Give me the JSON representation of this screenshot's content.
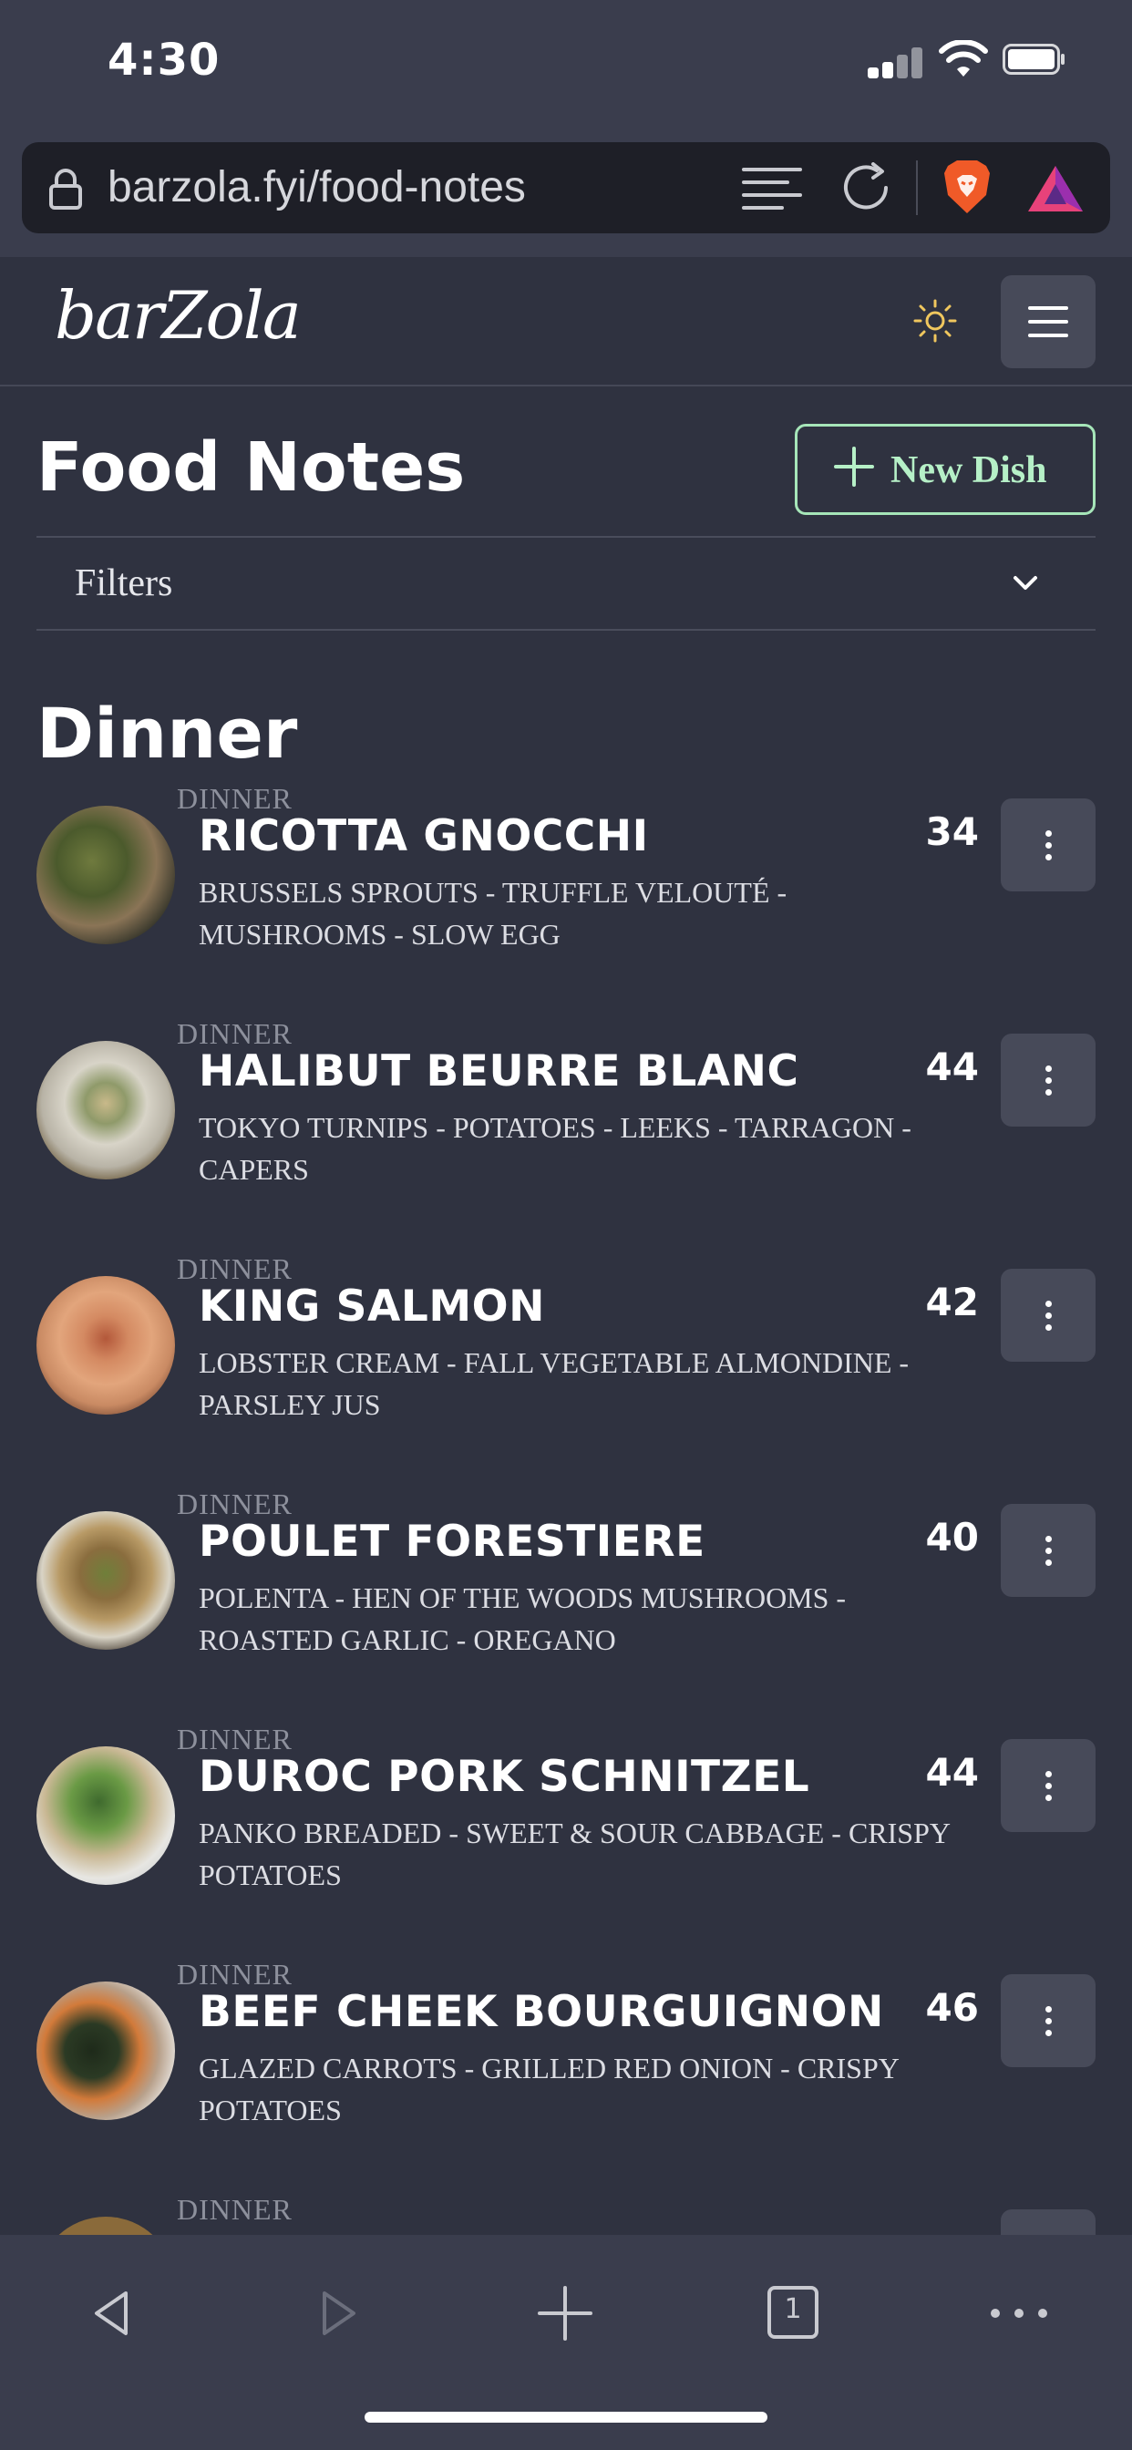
{
  "status_bar": {
    "time": "4:30"
  },
  "browser": {
    "url": "barzola.fyi/food-notes"
  },
  "site": {
    "logo_text": "barZola"
  },
  "page": {
    "title": "Food Notes",
    "new_dish_label": "New Dish",
    "filters_label": "Filters",
    "section_title": "Dinner"
  },
  "dishes": [
    {
      "category": "DINNER",
      "name": "RICOTTA GNOCCHI",
      "price": "34",
      "description": "BRUSSELS SPROUTS - TRUFFLE VELOUTÉ - MUSHROOMS - SLOW EGG"
    },
    {
      "category": "DINNER",
      "name": "HALIBUT BEURRE BLANC",
      "price": "44",
      "description": "TOKYO TURNIPS - POTATOES - LEEKS - TARRAGON - CAPERS"
    },
    {
      "category": "DINNER",
      "name": "KING SALMON",
      "price": "42",
      "description": "LOBSTER CREAM - FALL VEGETABLE ALMONDINE - PARSLEY JUS"
    },
    {
      "category": "DINNER",
      "name": "POULET FORESTIERE",
      "price": "40",
      "description": "POLENTA - HEN OF THE WOODS MUSHROOMS - ROASTED GARLIC - OREGANO"
    },
    {
      "category": "DINNER",
      "name": "DUROC PORK SCHNITZEL",
      "price": "44",
      "description": "PANKO BREADED - SWEET & SOUR CABBAGE - CRISPY POTATOES"
    },
    {
      "category": "DINNER",
      "name": "BEEF CHEEK BOURGUIGNON",
      "price": "46",
      "description": "GLAZED CARROTS - GRILLED RED ONION - CRISPY POTATOES"
    },
    {
      "category": "DINNER",
      "name": "",
      "price": "",
      "description": ""
    }
  ],
  "toolbar": {
    "tab_count": "1"
  },
  "colors": {
    "background": "#2f3240",
    "chrome": "#3a3d4d",
    "accent_green": "#a6e6b9",
    "button_gray": "#474a59"
  }
}
